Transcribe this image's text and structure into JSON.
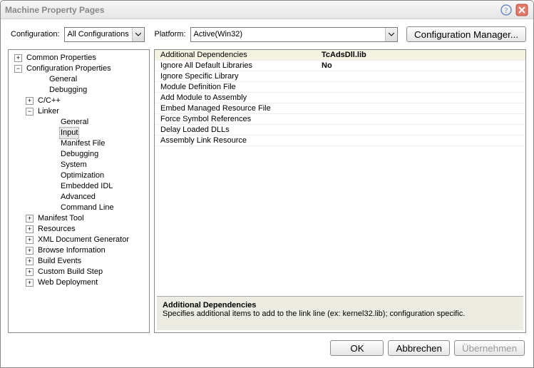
{
  "window": {
    "title": "Machine Property Pages"
  },
  "toolbar": {
    "configuration_label": "Configuration:",
    "configuration_value": "All Configurations",
    "platform_label": "Platform:",
    "platform_value": "Active(Win32)",
    "config_mgr_label": "Configuration Manager..."
  },
  "tree": {
    "common_properties": "Common Properties",
    "configuration_properties": "Configuration Properties",
    "general": "General",
    "debugging": "Debugging",
    "ccpp": "C/C++",
    "linker": "Linker",
    "linker_general": "General",
    "linker_input": "Input",
    "linker_manifest_file": "Manifest File",
    "linker_debugging": "Debugging",
    "linker_system": "System",
    "linker_optimization": "Optimization",
    "linker_embedded_idl": "Embedded IDL",
    "linker_advanced": "Advanced",
    "linker_command_line": "Command Line",
    "manifest_tool": "Manifest Tool",
    "resources": "Resources",
    "xml_doc_gen": "XML Document Generator",
    "browse_info": "Browse Information",
    "build_events": "Build Events",
    "custom_build_step": "Custom Build Step",
    "web_deployment": "Web Deployment"
  },
  "grid": {
    "rows": [
      {
        "name": "Additional Dependencies",
        "value": "TcAdsDll.lib",
        "hl": true,
        "bold": true
      },
      {
        "name": "Ignore All Default Libraries",
        "value": "No",
        "hl": false,
        "bold": true
      },
      {
        "name": "Ignore Specific Library",
        "value": "",
        "hl": false,
        "bold": false
      },
      {
        "name": "Module Definition File",
        "value": "",
        "hl": false,
        "bold": false
      },
      {
        "name": "Add Module to Assembly",
        "value": "",
        "hl": false,
        "bold": false
      },
      {
        "name": "Embed Managed Resource File",
        "value": "",
        "hl": false,
        "bold": false
      },
      {
        "name": "Force Symbol References",
        "value": "",
        "hl": false,
        "bold": false
      },
      {
        "name": "Delay Loaded DLLs",
        "value": "",
        "hl": false,
        "bold": false
      },
      {
        "name": "Assembly Link Resource",
        "value": "",
        "hl": false,
        "bold": false
      }
    ]
  },
  "description": {
    "title": "Additional Dependencies",
    "text": "Specifies additional items to add to the link line (ex: kernel32.lib); configuration specific."
  },
  "buttons": {
    "ok": "OK",
    "cancel": "Abbrechen",
    "apply": "Übernehmen"
  }
}
